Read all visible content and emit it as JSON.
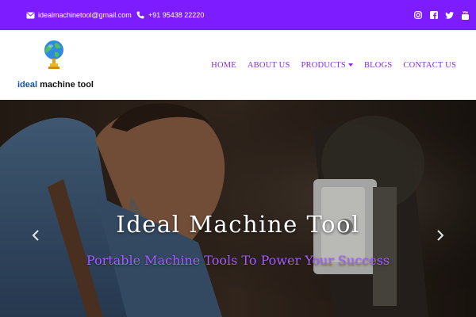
{
  "topbar": {
    "email": "idealmachinetool@gmail.com",
    "phone": "+91 95438 22220",
    "social_icons": [
      "instagram-icon",
      "facebook-icon",
      "twitter-icon",
      "youtube-icon"
    ]
  },
  "header": {
    "logo": {
      "brand_part1": "ideal",
      "brand_part2": " machine tool"
    },
    "nav": [
      {
        "label": "HOME"
      },
      {
        "label": "ABOUT US"
      },
      {
        "label": "PRODUCTS"
      },
      {
        "label": "BLOGS"
      },
      {
        "label": "CONTACT US"
      }
    ]
  },
  "hero": {
    "title": "Ideal Machine Tool",
    "subtitle": "Portable Machine Tools To Power Your Success"
  },
  "colors": {
    "topbar": "#7c1cff",
    "nav_link": "#8a2be2",
    "subtitle": "#a55cff"
  }
}
